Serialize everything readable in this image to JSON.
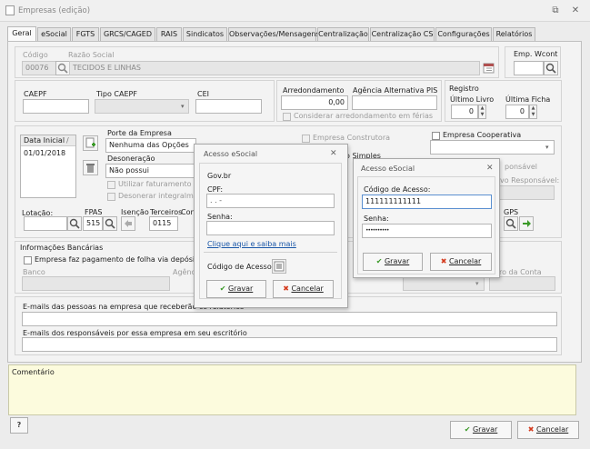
{
  "window": {
    "title": "Empresas (edição)",
    "minimize": "⧉",
    "close": "✕"
  },
  "tabs": [
    "Geral",
    "eSocial",
    "FGTS",
    "GRCS/CAGED",
    "RAIS",
    "Sindicatos",
    "Observações/Mensagens",
    "Centralização",
    "Centralização CS",
    "Configurações",
    "Relatórios"
  ],
  "empresa": {
    "codigo_label": "Código",
    "codigo_value": "00076",
    "razao_label": "Razão Social",
    "razao_value": "TECIDOS E LINHAS",
    "emp_wcont_label": "Emp. Wcont"
  },
  "fiscal": {
    "caepf_label": "CAEPF",
    "tipo_caepf_label": "Tipo CAEPF",
    "cei_label": "CEI",
    "arredondamento_label": "Arredondamento",
    "arredondamento_value": "0,00",
    "agencia_label": "Agência Alternativa PIS",
    "considerar_label": "Considerar arredondamento em férias",
    "registro_label": "Registro",
    "ultimo_livro_label": "Último Livro",
    "ultimo_livro_value": "0",
    "ultima_ficha_label": "Última Ficha",
    "ultima_ficha_value": "0"
  },
  "middle": {
    "data_inicial_header": "Data Inicial",
    "sort_mark": "/",
    "data_inicial_value": "01/01/2018",
    "porte_label": "Porte da Empresa",
    "porte_value": "Nenhuma das Opções",
    "desoneracao_label": "Desoneração",
    "desoneracao_value": "Não possui",
    "utilizar_label": "Utilizar faturamento co",
    "desonerar_label": "Desonerar integralment",
    "construtora_label": "Empresa Construtora",
    "simples_label": "o Simples",
    "cooperativa_label": "Empresa Cooperativa",
    "responsavel_label": "ponsável",
    "vo_responsavel_label": "vo Responsável:",
    "lotacao_label": "Lotação:",
    "fpas_label": "FPAS",
    "fpas_value": "515",
    "isencao_label": "Isenção",
    "terceiros_label": "Terceiros",
    "terceiros_value": "0115",
    "con_label": "Con",
    "gps_label": "GPS"
  },
  "bancario": {
    "title": "Informações Bancárias",
    "pagamento_label": "Empresa faz pagamento de folha via depósito ban",
    "banco_label": "Banco",
    "agencia_label": "Agênc",
    "conta_label": "nero da Conta"
  },
  "emails": {
    "empresa_label": "E-mails das pessoas na empresa que receberão os relatórios",
    "responsaveis_label": "E-mails dos responsáveis por essa empresa em seu escritório"
  },
  "comentario": {
    "label": "Comentário"
  },
  "footer": {
    "help": "?",
    "gravar": "Gravar",
    "cancelar": "Cancelar",
    "gravar_key": "G",
    "cancelar_key": "C"
  },
  "dialog1": {
    "title": "Acesso eSocial",
    "close": "✕",
    "govbr": "Gov.br",
    "cpf_label": "CPF:",
    "cpf_value": ".   .   -",
    "senha_label": "Senha:",
    "link": "Clique aqui e saiba mais",
    "codigo_label": "Código de Acesso:",
    "gravar": "Gravar",
    "cancelar": "Cancelar"
  },
  "dialog2": {
    "title": "Acesso eSocial",
    "close": "✕",
    "codigo_label": "Código de Acesso:",
    "codigo_value": "111111111111",
    "senha_label": "Senha:",
    "senha_value": "••••••••••",
    "gravar": "Gravar",
    "cancelar": "Cancelar"
  }
}
